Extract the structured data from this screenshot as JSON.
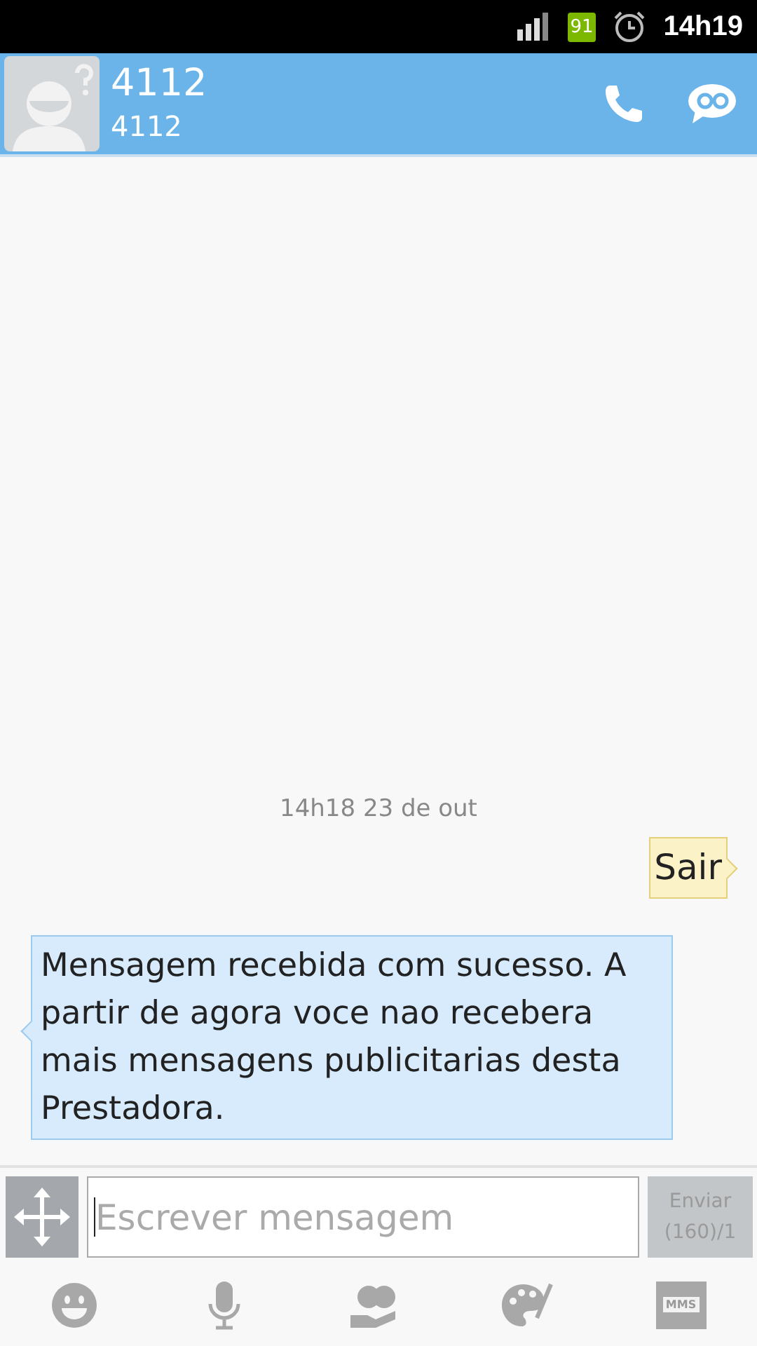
{
  "status_bar": {
    "battery": "91",
    "time": "14h19"
  },
  "contact": {
    "name": "4112",
    "number": "4112"
  },
  "conversation": {
    "timestamp": "14h18 23 de out",
    "messages": [
      {
        "kind": "sent",
        "text": "Sair"
      },
      {
        "kind": "received",
        "text": "Mensagem recebida com sucesso. A partir de agora voce nao recebera mais mensagens publicitarias desta Prestadora."
      }
    ]
  },
  "composer": {
    "placeholder": "Escrever mensagem",
    "send_label": "Enviar",
    "counter": "(160)/1"
  },
  "toolbar": {
    "mms_label": "MMS"
  }
}
